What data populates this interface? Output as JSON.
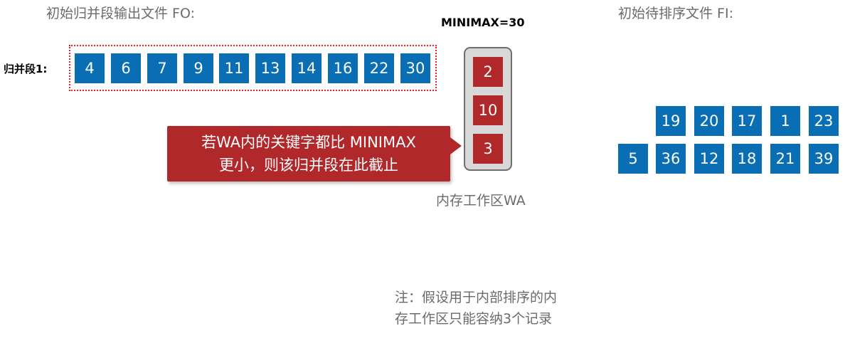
{
  "fo_title": "初始归并段输出文件 FO:",
  "fi_title": "初始待排序文件 FI:",
  "minimax_label": "MINIMAX=30",
  "segment_label": "归并段1:",
  "fo_values": [
    "4",
    "6",
    "7",
    "9",
    "11",
    "13",
    "14",
    "16",
    "22",
    "30"
  ],
  "wa_values": [
    "2",
    "10",
    "3"
  ],
  "wa_label": "内存工作区WA",
  "fi_row1": [
    "19",
    "20",
    "17",
    "1",
    "23"
  ],
  "fi_row2": [
    "5",
    "36",
    "12",
    "18",
    "21",
    "39"
  ],
  "callout": {
    "line1": "若WA内的关键字都比 MINIMAX",
    "line2": "更小，则该归并段在此截止"
  },
  "note": {
    "line1": "注：假设用于内部排序的内",
    "line2": "存工作区只能容纳3个记录"
  },
  "colors": {
    "blue": "#0a6eb4",
    "red": "#b0282a",
    "frame": "#e0262a"
  }
}
